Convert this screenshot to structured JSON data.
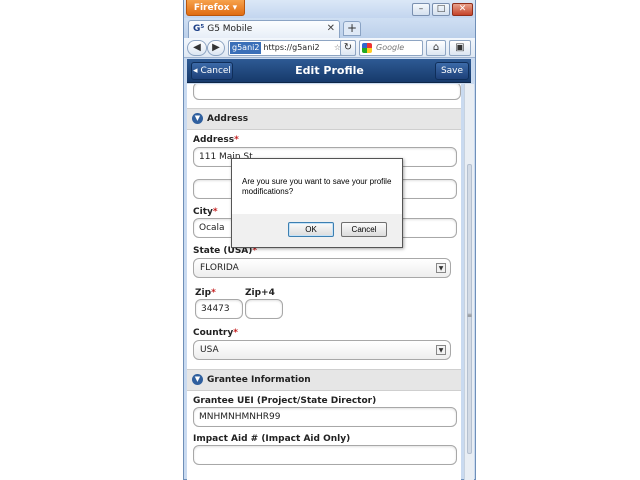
{
  "browser": {
    "menu_label": "Firefox",
    "window_controls": [
      "–",
      "□",
      "✕"
    ],
    "tab": {
      "logo": "G⁵",
      "title": "G5 Mobile",
      "close": "✕"
    },
    "new_tab": "+",
    "url": {
      "site_id": "g5ani2",
      "address": "https://g5ani2"
    },
    "search_placeholder": "Google"
  },
  "header": {
    "cancel_label": "Cancel",
    "title": "Edit Profile",
    "save_label": "Save"
  },
  "sections": {
    "address": "Address",
    "grantee": "Grantee Information"
  },
  "form": {
    "address_label": "Address",
    "address_value": "111 Main St",
    "address2_value": "",
    "city_label": "City",
    "city_value": "Ocala",
    "state_label": "State (USA)",
    "state_value": "FLORIDA",
    "zip_label": "Zip",
    "zip_value": "34473",
    "zip4_label": "Zip+4",
    "zip4_value": "",
    "country_label": "Country",
    "country_value": "USA",
    "uei_label": "Grantee UEI (Project/State Director)",
    "uei_value": "MNHMNHMNHR99",
    "impact_label": "Impact Aid # (Impact Aid Only)",
    "impact_value": "",
    "required_mark": "*"
  },
  "dialog": {
    "message": "Are you sure you want to save your profile modifications?",
    "ok_label": "OK",
    "cancel_label": "Cancel"
  }
}
